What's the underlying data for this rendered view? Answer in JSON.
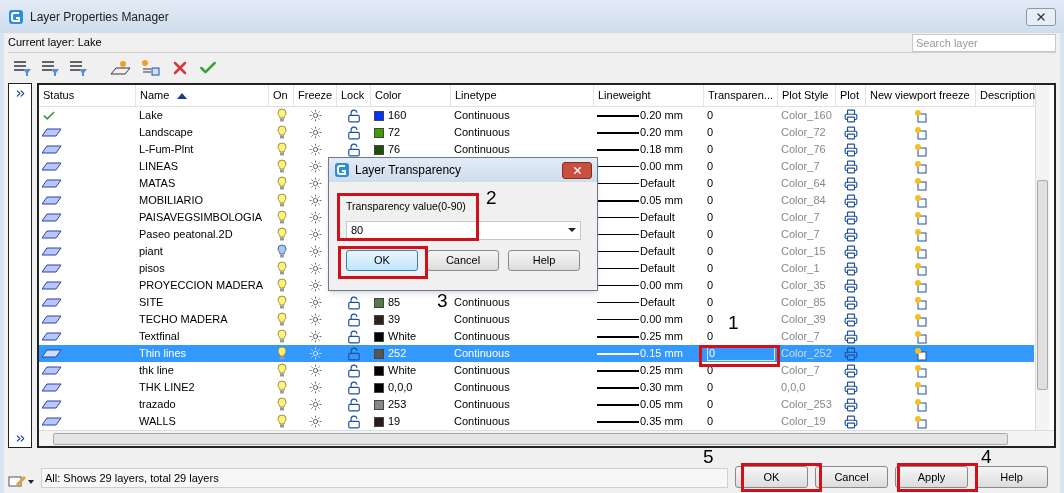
{
  "window": {
    "title": "Layer Properties Manager"
  },
  "current_layer": "Current layer: Lake",
  "search": {
    "placeholder": "Search layer"
  },
  "columns": [
    "Status",
    "Name",
    "On",
    "Freeze",
    "Lock",
    "Color",
    "Linetype",
    "Lineweight",
    "Transparen...",
    "Plot Style",
    "Plot",
    "New viewport freeze",
    "Description"
  ],
  "rows": [
    {
      "current": true,
      "name": "Lake",
      "on": true,
      "color_value": "160",
      "color": "#0033ff",
      "linetype": "Continuous",
      "lineweight": "0.20 mm",
      "thick": true,
      "transparency": "0",
      "plot_style": "Color_160",
      "selected": false
    },
    {
      "current": false,
      "name": "Landscape",
      "on": true,
      "color_value": "72",
      "color": "#3f9f00",
      "linetype": "Continuous",
      "lineweight": "0.20 mm",
      "thick": true,
      "transparency": "0",
      "plot_style": "Color_72",
      "selected": false
    },
    {
      "current": false,
      "name": "L-Fum-Plnt",
      "on": true,
      "color_value": "76",
      "color": "#1f4f00",
      "linetype": "Continuous",
      "lineweight": "0.18 mm",
      "thick": true,
      "transparency": "0",
      "plot_style": "Color_76",
      "selected": false
    },
    {
      "current": false,
      "name": "LINEAS",
      "on": true,
      "lineweight": "0.00 mm",
      "thick": false,
      "transparency": "0",
      "plot_style": "Color_7",
      "selected": false
    },
    {
      "current": false,
      "name": "MATAS",
      "on": true,
      "lineweight": "Default",
      "thick": false,
      "transparency": "0",
      "plot_style": "Color_64",
      "selected": false
    },
    {
      "current": false,
      "name": "MOBILIARIO",
      "on": true,
      "lineweight": "0.05 mm",
      "thick": true,
      "transparency": "0",
      "plot_style": "Color_84",
      "selected": false
    },
    {
      "current": false,
      "name": "PAISAVEGSIMBOLOGIA",
      "on": true,
      "lineweight": "Default",
      "thick": false,
      "transparency": "0",
      "plot_style": "Color_7",
      "selected": false
    },
    {
      "current": false,
      "name": "Paseo peatonal.2D",
      "on": true,
      "lineweight": "Default",
      "thick": false,
      "transparency": "0",
      "plot_style": "Color_7",
      "selected": false
    },
    {
      "current": false,
      "name": "piant",
      "on": false,
      "lineweight": "Default",
      "thick": false,
      "transparency": "0",
      "plot_style": "Color_15",
      "selected": false
    },
    {
      "current": false,
      "name": "pisos",
      "on": true,
      "lineweight": "Default",
      "thick": false,
      "transparency": "0",
      "plot_style": "Color_1",
      "selected": false
    },
    {
      "current": false,
      "name": "PROYECCION MADERA",
      "on": true,
      "lineweight": "0.00 mm",
      "thick": false,
      "transparency": "0",
      "plot_style": "Color_35",
      "selected": false
    },
    {
      "current": false,
      "name": "SITE",
      "on": true,
      "color_value": "85",
      "color": "#4f7f45",
      "linetype": "Continuous",
      "lineweight": "Default",
      "thick": false,
      "transparency": "0",
      "plot_style": "Color_85",
      "selected": false
    },
    {
      "current": false,
      "name": "TECHO MADERA",
      "on": true,
      "color_value": "39",
      "color": "#2f2218",
      "linetype": "Continuous",
      "lineweight": "0.00 mm",
      "thick": false,
      "transparency": "0",
      "plot_style": "Color_39",
      "selected": false
    },
    {
      "current": false,
      "name": "Textfinal",
      "on": true,
      "color_value": "White",
      "color": "#000000",
      "linetype": "Continuous",
      "lineweight": "0.25 mm",
      "thick": true,
      "transparency": "0",
      "plot_style": "Color_7",
      "selected": false
    },
    {
      "current": false,
      "name": "Thin lines",
      "on": true,
      "color_value": "252",
      "color": "#555555",
      "linetype": "Continuous",
      "lineweight": "0.15 mm",
      "thick": true,
      "transparency": "0",
      "plot_style": "Color_252",
      "selected": true
    },
    {
      "current": false,
      "name": "thk line",
      "on": true,
      "color_value": "White",
      "color": "#000000",
      "linetype": "Continuous",
      "lineweight": "0.25 mm",
      "thick": true,
      "transparency": "0",
      "plot_style": "Color_7",
      "selected": false
    },
    {
      "current": false,
      "name": "THK LINE2",
      "on": true,
      "color_value": "0,0,0",
      "color": "#000000",
      "linetype": "Continuous",
      "lineweight": "0.30 mm",
      "thick": true,
      "transparency": "0",
      "plot_style": "0,0,0",
      "selected": false
    },
    {
      "current": false,
      "name": "trazado",
      "on": true,
      "color_value": "253",
      "color": "#888888",
      "linetype": "Continuous",
      "lineweight": "0.05 mm",
      "thick": true,
      "transparency": "0",
      "plot_style": "Color_253",
      "selected": false
    },
    {
      "current": false,
      "name": "WALLS",
      "on": true,
      "color_value": "19",
      "color": "#2a1a18",
      "linetype": "Continuous",
      "lineweight": "0.35 mm",
      "thick": true,
      "transparency": "0",
      "plot_style": "Color_19",
      "selected": false
    }
  ],
  "status_bar": "All: Shows 29 layers, total 29 layers",
  "buttons": [
    "OK",
    "Cancel",
    "Apply",
    "Help"
  ],
  "dialog": {
    "title": "Layer Transparency",
    "label": "Transparency value(0-90)",
    "value": "80",
    "buttons": [
      "OK",
      "Cancel",
      "Help"
    ]
  },
  "callouts": [
    {
      "label": "1"
    },
    {
      "label": "2"
    },
    {
      "label": "3"
    },
    {
      "label": "4"
    },
    {
      "label": "5"
    }
  ]
}
